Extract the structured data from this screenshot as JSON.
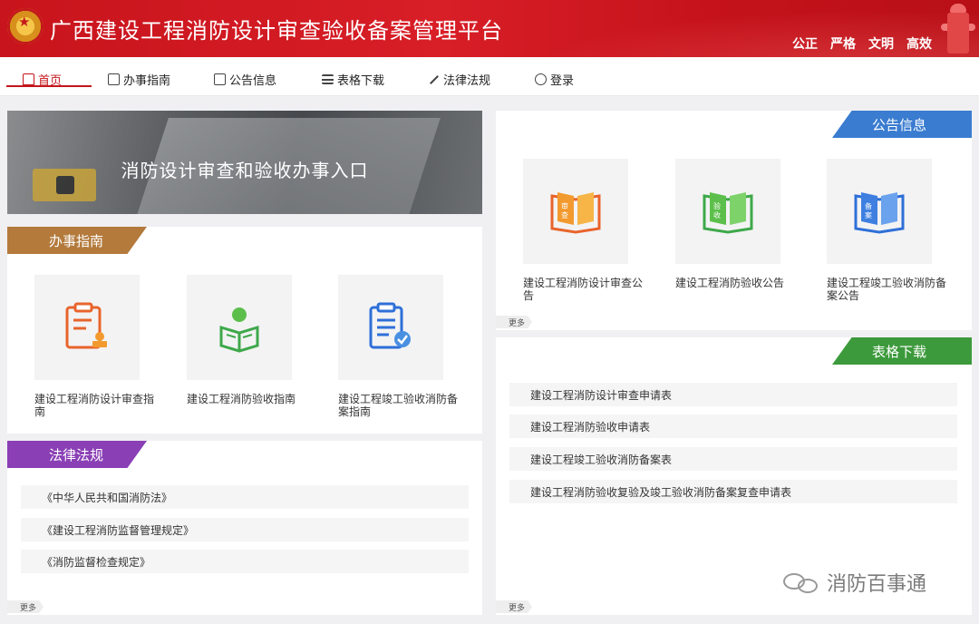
{
  "header": {
    "title": "广西建设工程消防设计审查验收备案管理平台",
    "slogans": [
      "公正",
      "严格",
      "文明",
      "高效"
    ]
  },
  "nav": {
    "items": [
      {
        "label": "首页",
        "icon": "home-icon",
        "active": true
      },
      {
        "label": "办事指南",
        "icon": "document-icon"
      },
      {
        "label": "公告信息",
        "icon": "notice-icon"
      },
      {
        "label": "表格下载",
        "icon": "list-icon"
      },
      {
        "label": "法律法规",
        "icon": "scale-icon"
      },
      {
        "label": "登录",
        "icon": "user-icon"
      }
    ]
  },
  "banner": {
    "title": "消防设计审查和验收办事入口"
  },
  "guide": {
    "label": "办事指南",
    "color": "#b37a3c",
    "cards": [
      {
        "caption": "建设工程消防设计审查指南",
        "icon": "clipboard-stamp-icon"
      },
      {
        "caption": "建设工程消防验收指南",
        "icon": "reader-book-icon"
      },
      {
        "caption": "建设工程竣工验收消防备案指南",
        "icon": "checklist-icon"
      }
    ]
  },
  "laws": {
    "label": "法律法规",
    "color": "#8a3fb5",
    "items": [
      "《中华人民共和国消防法》",
      "《建设工程消防监督管理规定》",
      "《消防监督检查规定》"
    ],
    "more": "更多"
  },
  "notices": {
    "label": "公告信息",
    "color": "#3a7cd0",
    "cards": [
      {
        "caption": "建设工程消防设计审查公告",
        "book_char1": "审",
        "book_char2": "查",
        "color": "#e8642c"
      },
      {
        "caption": "建设工程消防验收公告",
        "book_char1": "验",
        "book_char2": "收",
        "color": "#3ea84a"
      },
      {
        "caption": "建设工程竣工验收消防备案公告",
        "book_char1": "备",
        "book_char2": "案",
        "color": "#2e6fd8"
      }
    ],
    "more": "更多"
  },
  "forms": {
    "label": "表格下载",
    "color": "#3d9a3c",
    "items": [
      "建设工程消防设计审查申请表",
      "建设工程消防验收申请表",
      "建设工程竣工验收消防备案表",
      "建设工程消防验收复验及竣工验收消防备案复查申请表"
    ],
    "more": "更多"
  },
  "watermark": {
    "text": "消防百事通"
  }
}
